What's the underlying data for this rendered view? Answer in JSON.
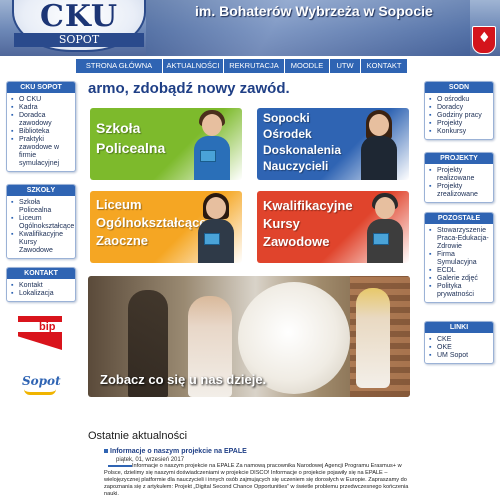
{
  "header": {
    "logo_main": "CKU",
    "logo_sub": "SOPOT",
    "title": "im. Bohaterów Wybrzeża w Sopocie",
    "eagle_glyph": "♦"
  },
  "nav": {
    "items": [
      {
        "label": "Strona główna"
      },
      {
        "label": "Aktualności"
      },
      {
        "label": "Rekrutacja"
      },
      {
        "label": "Moodle"
      },
      {
        "label": "UTW"
      },
      {
        "label": "Kontakt"
      }
    ]
  },
  "left": {
    "cku": {
      "title": "CKU Sopot",
      "items": [
        "O CKU",
        "Kadra",
        "Doradca zawodowy",
        "Biblioteka",
        "Praktyki zawodowe w firmie symulacyjnej"
      ]
    },
    "szkoly": {
      "title": "Szkoły",
      "items": [
        "Szkoła Policealna",
        "Liceum Ogólnokształcące",
        "Kwalifikacyjne Kursy Zawodowe"
      ]
    },
    "kontakt": {
      "title": "Kontakt",
      "items": [
        "Kontakt",
        "Lokalizacja"
      ]
    },
    "bip_label": "bip",
    "sopot_label": "Sopot"
  },
  "right": {
    "sodn": {
      "title": "SODN",
      "items": [
        "O ośrodku",
        "Doradcy",
        "Godziny pracy",
        "Projekty",
        "Konkursy"
      ]
    },
    "projekty": {
      "title": "Projekty",
      "items": [
        "Projekty realizowane",
        "Projekty zrealizowane"
      ]
    },
    "pozostale": {
      "title": "Pozostałe",
      "items": [
        "Stowarzyszenie Praca-Edukacja-Zdrowie",
        "Firma Symulacyjna",
        "ECDL",
        "Galerie zdjęć",
        "Polityka prywatności"
      ]
    },
    "linki": {
      "title": "Linki",
      "items": [
        "CKE",
        "OKE",
        "UM Sopot"
      ]
    }
  },
  "main": {
    "slogan": "armo, zdobądź nowy zawód.",
    "tiles": [
      {
        "line1": "Szkoła",
        "line2": "Policealna",
        "color": "#7dba2c"
      },
      {
        "line1": "Sopocki",
        "line2": "Ośrodek",
        "line3": "Doskonalenia",
        "line4": "Nauczycieli",
        "color": "#2f64b3"
      },
      {
        "line1": "Liceum",
        "line2": "Ogólnokształcące",
        "line3": "Zaoczne",
        "color": "#f5a623"
      },
      {
        "line1": "Kwalifikacyjne",
        "line2": "Kursy",
        "line3": "Zawodowe",
        "color": "#e0442c"
      }
    ],
    "banner_caption": "Zobacz co się u nas dzieje."
  },
  "news": {
    "heading": "Ostatnie aktualności",
    "item": {
      "title": "Informacje o naszym projekcie na EPALE",
      "date": "piątek, 01, wrzesień 2017",
      "body": "Informacje o naszym projekcie na EPALE Za namową pracownika Narodowej Agencji Programu Erasmus+ w Polsce, dzielimy się naszymi doświadczeniami w projekcie DISCO! Informacje o projekcie pojawiły się na EPALE – wielojęzycznej platformie dla nauczycieli i innych osób zajmujących się uczeniem się dorosłych w Europie. Zapraszamy do zapoznania się z artykułem: Projekt „Digital Second Chance Opportunities” w świetle problemu przedwczesnego kończenia nauki."
    }
  }
}
